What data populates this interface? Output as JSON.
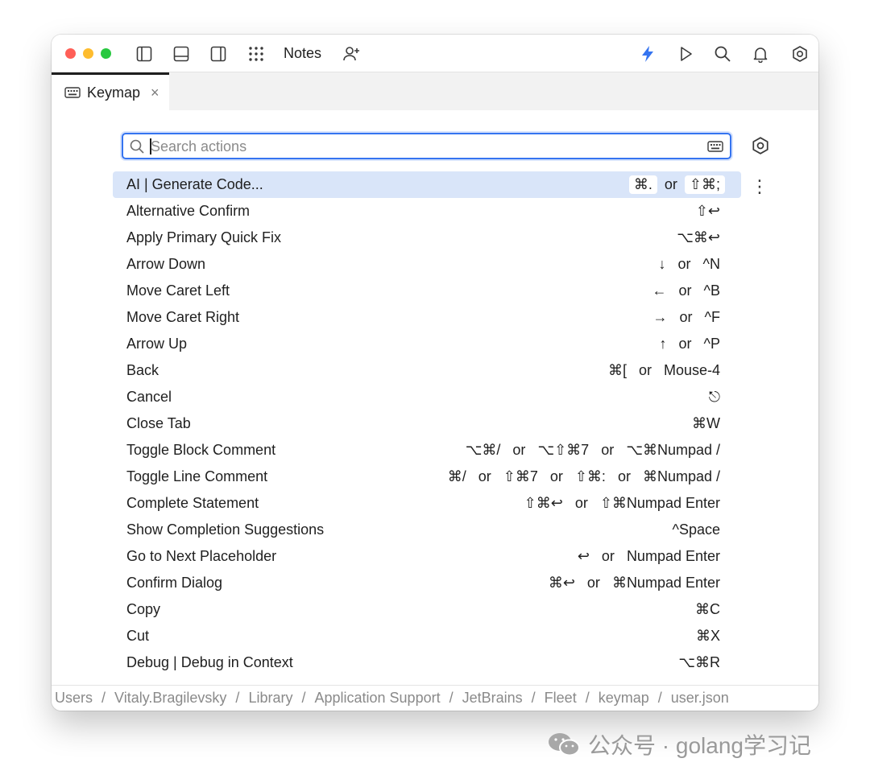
{
  "window": {
    "title": "Notes"
  },
  "colors": {
    "accent": "#3574f0",
    "ai_bolt": "#3574f0",
    "selection": "#d9e5f9",
    "close_red": "#ff5f57",
    "minimize_yellow": "#febc2e",
    "zoom_green": "#28c840"
  },
  "titlebar": {
    "icons": [
      "left-panel-icon",
      "bottom-panel-icon",
      "right-panel-icon",
      "apps-grid-icon",
      "add-user-icon",
      "ai-bolt-icon",
      "run-icon",
      "search-icon",
      "bell-icon",
      "settings-icon"
    ]
  },
  "tab": {
    "label": "Keymap",
    "close": "×"
  },
  "search": {
    "placeholder": "Search actions",
    "value": ""
  },
  "actions": [
    {
      "name": "AI | Generate Code...",
      "keys": [
        "⌘.",
        "⇧⌘;"
      ],
      "selected": true
    },
    {
      "name": "Alternative Confirm",
      "keys": [
        "⇧↩"
      ]
    },
    {
      "name": "Apply Primary Quick Fix",
      "keys": [
        "⌥⌘↩"
      ]
    },
    {
      "name": "Arrow Down",
      "keys": [
        "↓",
        "^N"
      ]
    },
    {
      "name": "Move Caret Left",
      "keys": [
        "←",
        "^B"
      ]
    },
    {
      "name": "Move Caret Right",
      "keys": [
        "→",
        "^F"
      ]
    },
    {
      "name": "Arrow Up",
      "keys": [
        "↑",
        "^P"
      ]
    },
    {
      "name": "Back",
      "keys": [
        "⌘[",
        "Mouse-4"
      ]
    },
    {
      "name": "Cancel",
      "keys": [
        "⎋"
      ]
    },
    {
      "name": "Close Tab",
      "keys": [
        "⌘W"
      ]
    },
    {
      "name": "Toggle Block Comment",
      "keys": [
        "⌥⌘/",
        "⌥⇧⌘7",
        "⌥⌘Numpad /"
      ]
    },
    {
      "name": "Toggle Line Comment",
      "keys": [
        "⌘/",
        "⇧⌘7",
        "⇧⌘:",
        "⌘Numpad /"
      ]
    },
    {
      "name": "Complete Statement",
      "keys": [
        "⇧⌘↩",
        "⇧⌘Numpad Enter"
      ]
    },
    {
      "name": "Show Completion Suggestions",
      "keys": [
        "^Space"
      ]
    },
    {
      "name": "Go to Next Placeholder",
      "keys": [
        "↩",
        "Numpad Enter"
      ]
    },
    {
      "name": "Confirm Dialog",
      "keys": [
        "⌘↩",
        "⌘Numpad Enter"
      ]
    },
    {
      "name": "Copy",
      "keys": [
        "⌘C"
      ]
    },
    {
      "name": "Cut",
      "keys": [
        "⌘X"
      ]
    },
    {
      "name": "Debug | Debug in Context",
      "keys": [
        "⌥⌘R"
      ]
    }
  ],
  "or_label": "or",
  "more_button": "⋮",
  "path": {
    "segments": [
      "Users",
      "Vitaly.Bragilevsky",
      "Library",
      "Application Support",
      "JetBrains",
      "Fleet",
      "keymap",
      "user.json"
    ],
    "separator": "/"
  },
  "watermark": {
    "text": "公众号 · golang学习记"
  }
}
